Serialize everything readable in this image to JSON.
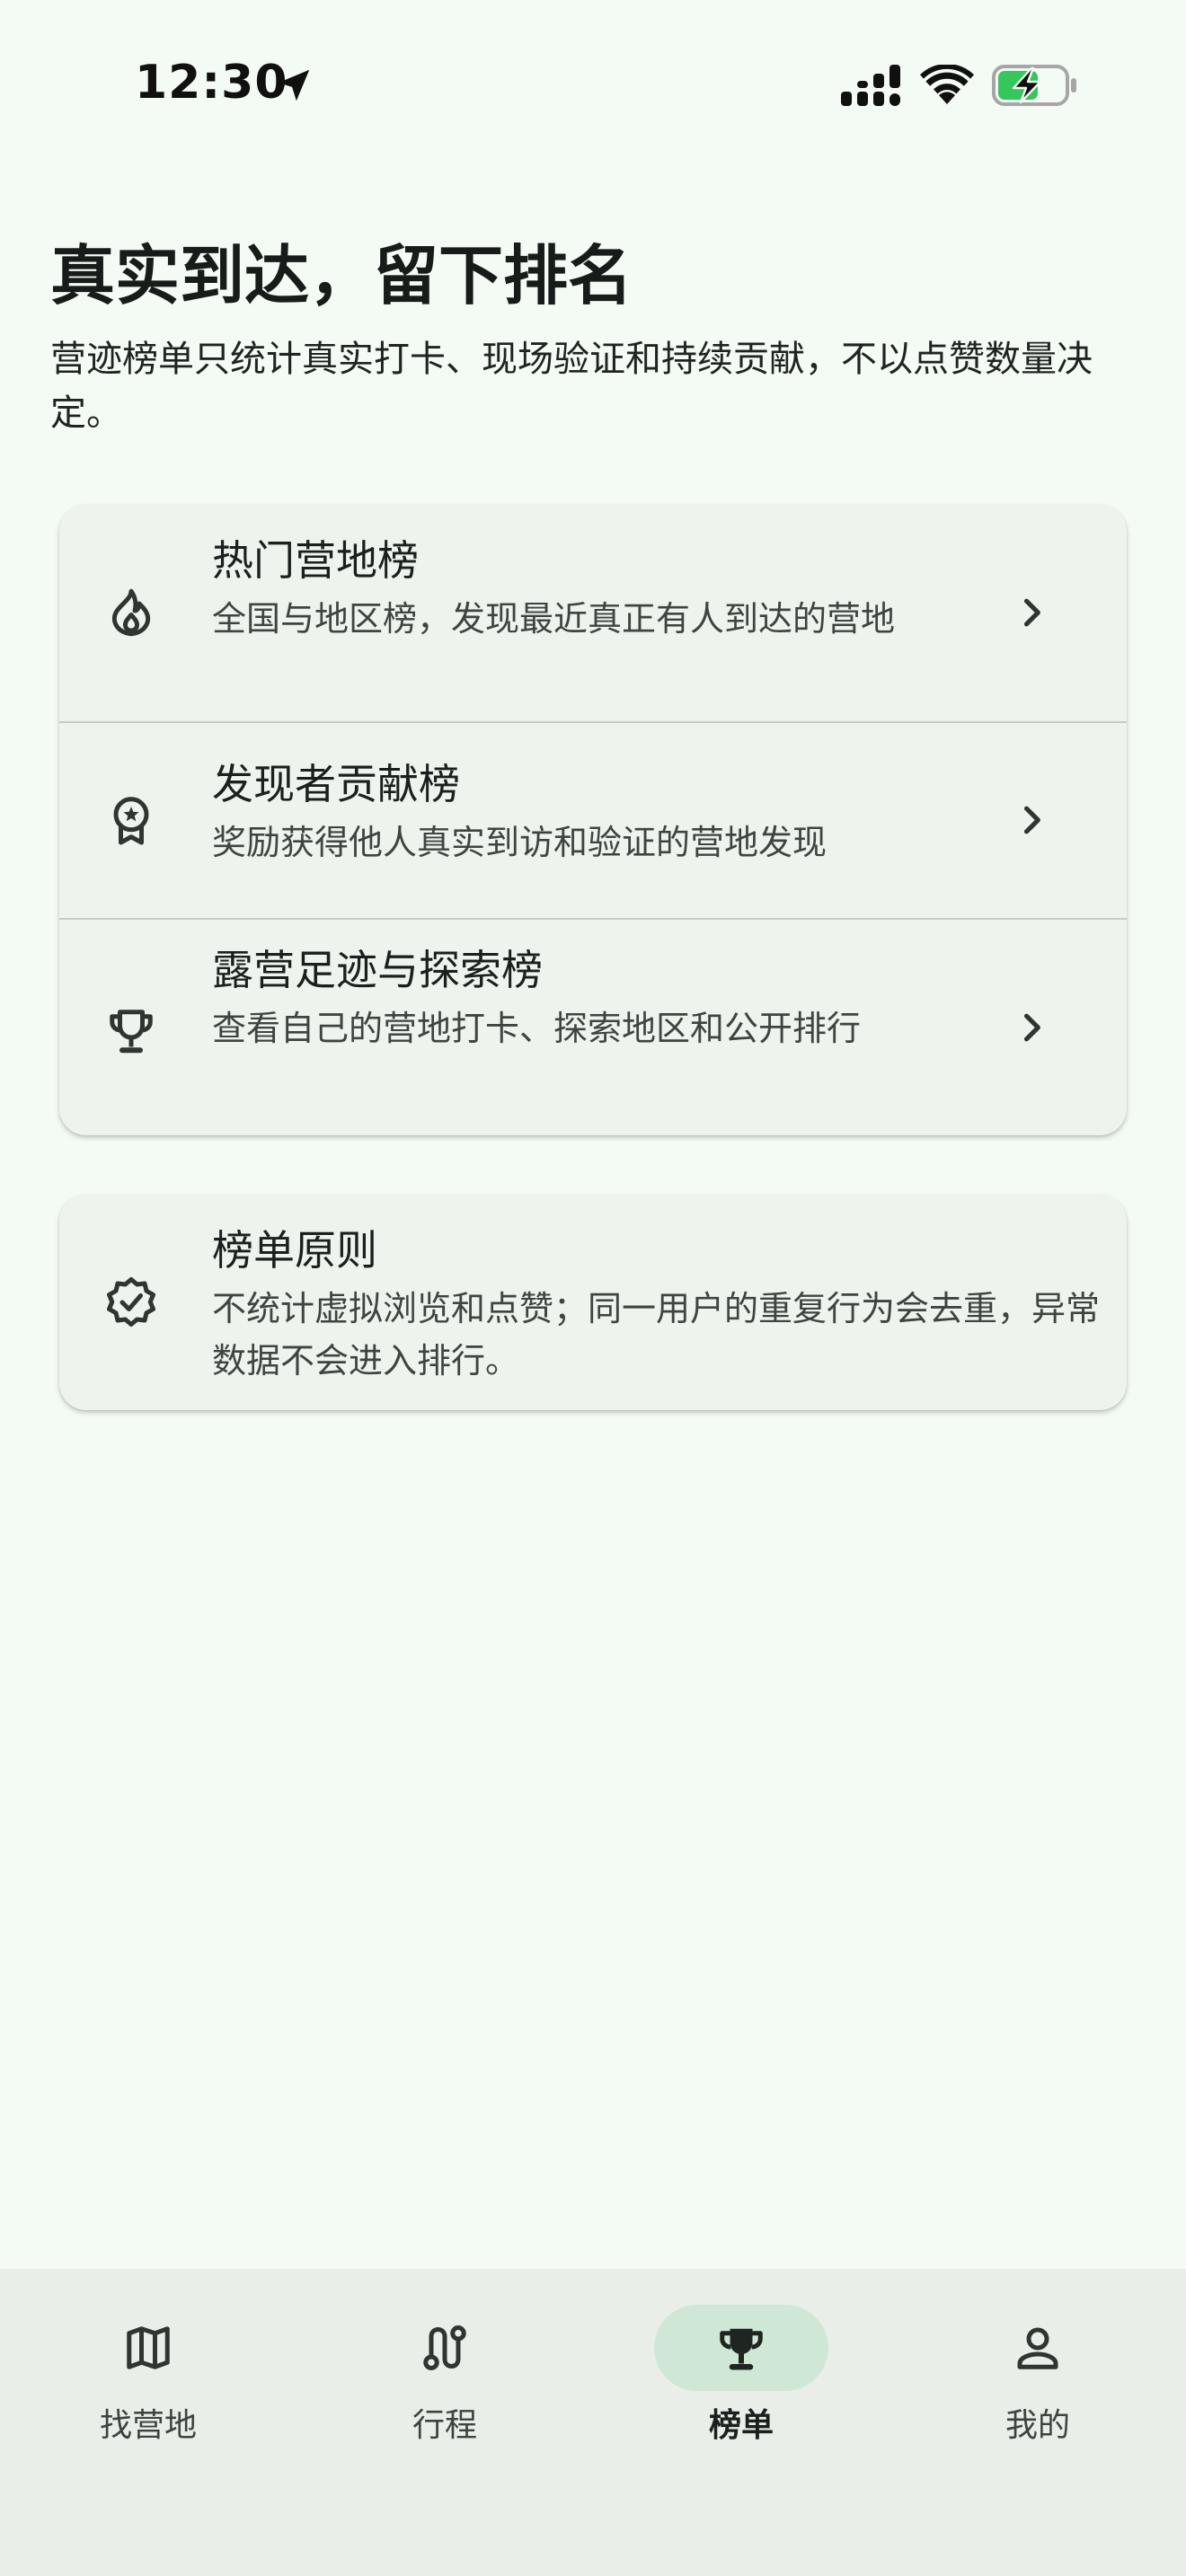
{
  "status_bar": {
    "time": "12:30"
  },
  "header": {
    "title": "真实到达，留下排名",
    "subtitle": "营迹榜单只统计真实打卡、现场验证和持续贡献，不以点赞数量决定。"
  },
  "leaderboards": [
    {
      "title": "热门营地榜",
      "description": "全国与地区榜，发现最近真正有人到达的营地",
      "icon": "fire-icon"
    },
    {
      "title": "发现者贡献榜",
      "description": "奖励获得他人真实到访和验证的营地发现",
      "icon": "award-badge-icon"
    },
    {
      "title": "露营足迹与探索榜",
      "description": "查看自己的营地打卡、探索地区和公开排行",
      "icon": "trophy-icon"
    }
  ],
  "principles": {
    "title": "榜单原则",
    "description": "不统计虚拟浏览和点赞；同一用户的重复行为会去重，异常数据不会进入排行。",
    "icon": "verified-badge-icon"
  },
  "bottom_nav": {
    "active": "榜单",
    "items": [
      {
        "label": "找营地",
        "icon": "map-icon"
      },
      {
        "label": "行程",
        "icon": "route-icon"
      },
      {
        "label": "榜单",
        "icon": "trophy-icon"
      },
      {
        "label": "我的",
        "icon": "person-icon"
      }
    ]
  },
  "colors": {
    "background": "#f4faf4",
    "card": "#eef3ee",
    "nav_background": "#e9eee9",
    "active_pill": "#cfe8d5",
    "battery_fill": "#34c759"
  }
}
